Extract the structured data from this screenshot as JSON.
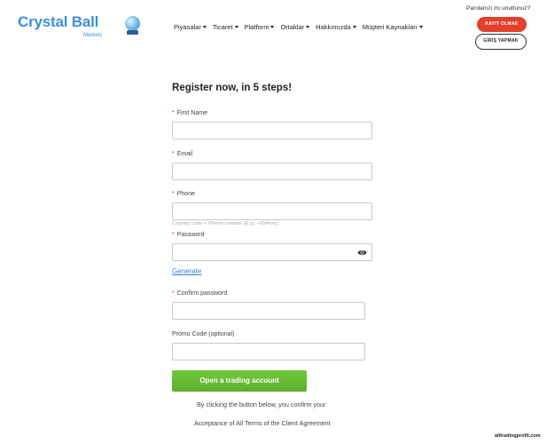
{
  "header": {
    "logo_text": "Crystal Ball",
    "logo_sub": "Markets",
    "nav": [
      {
        "label": "Piyasalar"
      },
      {
        "label": "Ticaret"
      },
      {
        "label": "Platform"
      },
      {
        "label": "Ortaklar"
      },
      {
        "label": "Hakkımızda"
      },
      {
        "label": "Müşteri Kaynakları"
      }
    ],
    "forgot_password": "Parolanızı mı unuttunuz?",
    "register_button": "KAYIT OLMAK",
    "login_button": "GİRİŞ YAPMAK"
  },
  "form": {
    "title": "Register now, in 5 steps!",
    "required_mark": "*",
    "first_name_label": "First Name",
    "first_name_value": "",
    "email_label": "Email",
    "email_value": "",
    "phone_label": "Phone",
    "phone_value": "",
    "phone_hint": "Country code + Phone number (E.g.: +694xxx)",
    "password_label": "Password",
    "password_value": "",
    "generate_link": "Generate",
    "confirm_password_label": "Confirm password",
    "confirm_password_value": "",
    "promo_label": "Promo Code (optional)",
    "promo_value": "",
    "submit_button": "Open a trading account",
    "terms_line1": "By clicking the button below, you confirm your",
    "terms_line2": "Acceptance of All Terms of the Client Agreement"
  },
  "watermark": "alltradingprofit.com",
  "colors": {
    "brand_blue": "#3c8fd6",
    "register_red": "#e0402d",
    "submit_green": "#5bb02a",
    "link_blue": "#3c7fd1"
  },
  "icons": {
    "password_toggle": "eye-icon",
    "logo": "crystal-ball-icon"
  }
}
